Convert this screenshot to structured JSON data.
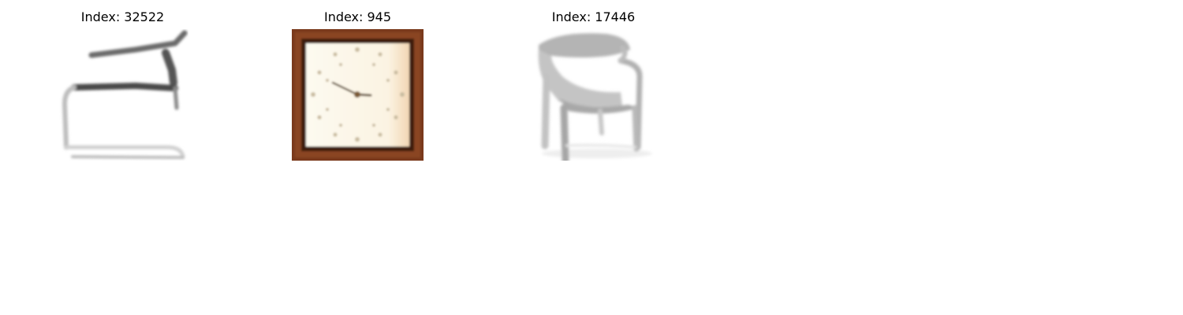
{
  "panels": [
    {
      "title": "Index: 32522",
      "subject": "cantilever-chair"
    },
    {
      "title": "Index: 945",
      "subject": "wall-clock"
    },
    {
      "title": "Index: 17446",
      "subject": "armchair"
    }
  ],
  "colors": {
    "background": "#ffffff",
    "clock_frame": "#7a3a1c",
    "clock_face": "#fbf6ea",
    "chair_grey": "#9e9e9e",
    "chair_dark": "#4a4a4a"
  }
}
